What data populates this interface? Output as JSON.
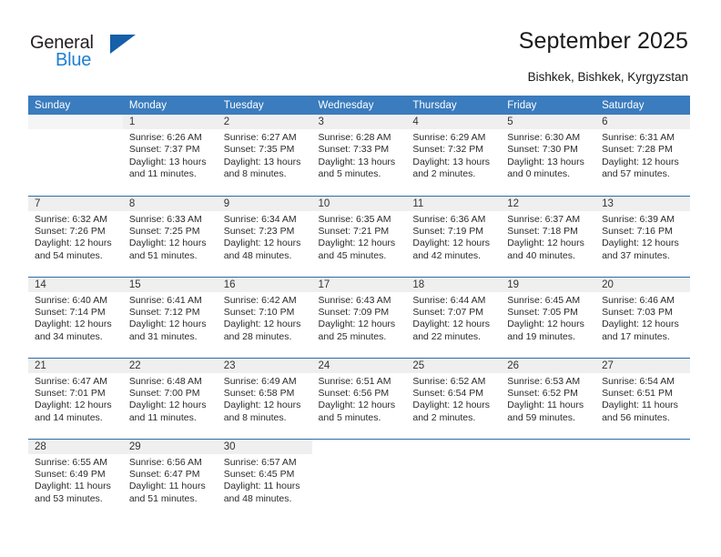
{
  "brand": {
    "name_part1": "General",
    "name_part2": "Blue",
    "accent_color": "#1c7fd4",
    "triangle_color": "#1560a8"
  },
  "header": {
    "title": "September 2025",
    "location": "Bishkek, Bishkek, Kyrgyzstan"
  },
  "calendar": {
    "header_bg": "#3a7cbe",
    "separator_color": "#2d6ca8",
    "daynum_bg": "#efefef",
    "weekdays": [
      "Sunday",
      "Monday",
      "Tuesday",
      "Wednesday",
      "Thursday",
      "Friday",
      "Saturday"
    ],
    "weeks": [
      [
        {
          "day": "",
          "empty": true
        },
        {
          "day": "1",
          "sunrise": "Sunrise: 6:26 AM",
          "sunset": "Sunset: 7:37 PM",
          "daylight_1": "Daylight: 13 hours",
          "daylight_2": "and 11 minutes."
        },
        {
          "day": "2",
          "sunrise": "Sunrise: 6:27 AM",
          "sunset": "Sunset: 7:35 PM",
          "daylight_1": "Daylight: 13 hours",
          "daylight_2": "and 8 minutes."
        },
        {
          "day": "3",
          "sunrise": "Sunrise: 6:28 AM",
          "sunset": "Sunset: 7:33 PM",
          "daylight_1": "Daylight: 13 hours",
          "daylight_2": "and 5 minutes."
        },
        {
          "day": "4",
          "sunrise": "Sunrise: 6:29 AM",
          "sunset": "Sunset: 7:32 PM",
          "daylight_1": "Daylight: 13 hours",
          "daylight_2": "and 2 minutes."
        },
        {
          "day": "5",
          "sunrise": "Sunrise: 6:30 AM",
          "sunset": "Sunset: 7:30 PM",
          "daylight_1": "Daylight: 13 hours",
          "daylight_2": "and 0 minutes."
        },
        {
          "day": "6",
          "sunrise": "Sunrise: 6:31 AM",
          "sunset": "Sunset: 7:28 PM",
          "daylight_1": "Daylight: 12 hours",
          "daylight_2": "and 57 minutes."
        }
      ],
      [
        {
          "day": "7",
          "sunrise": "Sunrise: 6:32 AM",
          "sunset": "Sunset: 7:26 PM",
          "daylight_1": "Daylight: 12 hours",
          "daylight_2": "and 54 minutes."
        },
        {
          "day": "8",
          "sunrise": "Sunrise: 6:33 AM",
          "sunset": "Sunset: 7:25 PM",
          "daylight_1": "Daylight: 12 hours",
          "daylight_2": "and 51 minutes."
        },
        {
          "day": "9",
          "sunrise": "Sunrise: 6:34 AM",
          "sunset": "Sunset: 7:23 PM",
          "daylight_1": "Daylight: 12 hours",
          "daylight_2": "and 48 minutes."
        },
        {
          "day": "10",
          "sunrise": "Sunrise: 6:35 AM",
          "sunset": "Sunset: 7:21 PM",
          "daylight_1": "Daylight: 12 hours",
          "daylight_2": "and 45 minutes."
        },
        {
          "day": "11",
          "sunrise": "Sunrise: 6:36 AM",
          "sunset": "Sunset: 7:19 PM",
          "daylight_1": "Daylight: 12 hours",
          "daylight_2": "and 42 minutes."
        },
        {
          "day": "12",
          "sunrise": "Sunrise: 6:37 AM",
          "sunset": "Sunset: 7:18 PM",
          "daylight_1": "Daylight: 12 hours",
          "daylight_2": "and 40 minutes."
        },
        {
          "day": "13",
          "sunrise": "Sunrise: 6:39 AM",
          "sunset": "Sunset: 7:16 PM",
          "daylight_1": "Daylight: 12 hours",
          "daylight_2": "and 37 minutes."
        }
      ],
      [
        {
          "day": "14",
          "sunrise": "Sunrise: 6:40 AM",
          "sunset": "Sunset: 7:14 PM",
          "daylight_1": "Daylight: 12 hours",
          "daylight_2": "and 34 minutes."
        },
        {
          "day": "15",
          "sunrise": "Sunrise: 6:41 AM",
          "sunset": "Sunset: 7:12 PM",
          "daylight_1": "Daylight: 12 hours",
          "daylight_2": "and 31 minutes."
        },
        {
          "day": "16",
          "sunrise": "Sunrise: 6:42 AM",
          "sunset": "Sunset: 7:10 PM",
          "daylight_1": "Daylight: 12 hours",
          "daylight_2": "and 28 minutes."
        },
        {
          "day": "17",
          "sunrise": "Sunrise: 6:43 AM",
          "sunset": "Sunset: 7:09 PM",
          "daylight_1": "Daylight: 12 hours",
          "daylight_2": "and 25 minutes."
        },
        {
          "day": "18",
          "sunrise": "Sunrise: 6:44 AM",
          "sunset": "Sunset: 7:07 PM",
          "daylight_1": "Daylight: 12 hours",
          "daylight_2": "and 22 minutes."
        },
        {
          "day": "19",
          "sunrise": "Sunrise: 6:45 AM",
          "sunset": "Sunset: 7:05 PM",
          "daylight_1": "Daylight: 12 hours",
          "daylight_2": "and 19 minutes."
        },
        {
          "day": "20",
          "sunrise": "Sunrise: 6:46 AM",
          "sunset": "Sunset: 7:03 PM",
          "daylight_1": "Daylight: 12 hours",
          "daylight_2": "and 17 minutes."
        }
      ],
      [
        {
          "day": "21",
          "sunrise": "Sunrise: 6:47 AM",
          "sunset": "Sunset: 7:01 PM",
          "daylight_1": "Daylight: 12 hours",
          "daylight_2": "and 14 minutes."
        },
        {
          "day": "22",
          "sunrise": "Sunrise: 6:48 AM",
          "sunset": "Sunset: 7:00 PM",
          "daylight_1": "Daylight: 12 hours",
          "daylight_2": "and 11 minutes."
        },
        {
          "day": "23",
          "sunrise": "Sunrise: 6:49 AM",
          "sunset": "Sunset: 6:58 PM",
          "daylight_1": "Daylight: 12 hours",
          "daylight_2": "and 8 minutes."
        },
        {
          "day": "24",
          "sunrise": "Sunrise: 6:51 AM",
          "sunset": "Sunset: 6:56 PM",
          "daylight_1": "Daylight: 12 hours",
          "daylight_2": "and 5 minutes."
        },
        {
          "day": "25",
          "sunrise": "Sunrise: 6:52 AM",
          "sunset": "Sunset: 6:54 PM",
          "daylight_1": "Daylight: 12 hours",
          "daylight_2": "and 2 minutes."
        },
        {
          "day": "26",
          "sunrise": "Sunrise: 6:53 AM",
          "sunset": "Sunset: 6:52 PM",
          "daylight_1": "Daylight: 11 hours",
          "daylight_2": "and 59 minutes."
        },
        {
          "day": "27",
          "sunrise": "Sunrise: 6:54 AM",
          "sunset": "Sunset: 6:51 PM",
          "daylight_1": "Daylight: 11 hours",
          "daylight_2": "and 56 minutes."
        }
      ],
      [
        {
          "day": "28",
          "sunrise": "Sunrise: 6:55 AM",
          "sunset": "Sunset: 6:49 PM",
          "daylight_1": "Daylight: 11 hours",
          "daylight_2": "and 53 minutes."
        },
        {
          "day": "29",
          "sunrise": "Sunrise: 6:56 AM",
          "sunset": "Sunset: 6:47 PM",
          "daylight_1": "Daylight: 11 hours",
          "daylight_2": "and 51 minutes."
        },
        {
          "day": "30",
          "sunrise": "Sunrise: 6:57 AM",
          "sunset": "Sunset: 6:45 PM",
          "daylight_1": "Daylight: 11 hours",
          "daylight_2": "and 48 minutes."
        },
        {
          "day": "",
          "blank": true
        },
        {
          "day": "",
          "blank": true
        },
        {
          "day": "",
          "blank": true
        },
        {
          "day": "",
          "blank": true
        }
      ]
    ]
  }
}
